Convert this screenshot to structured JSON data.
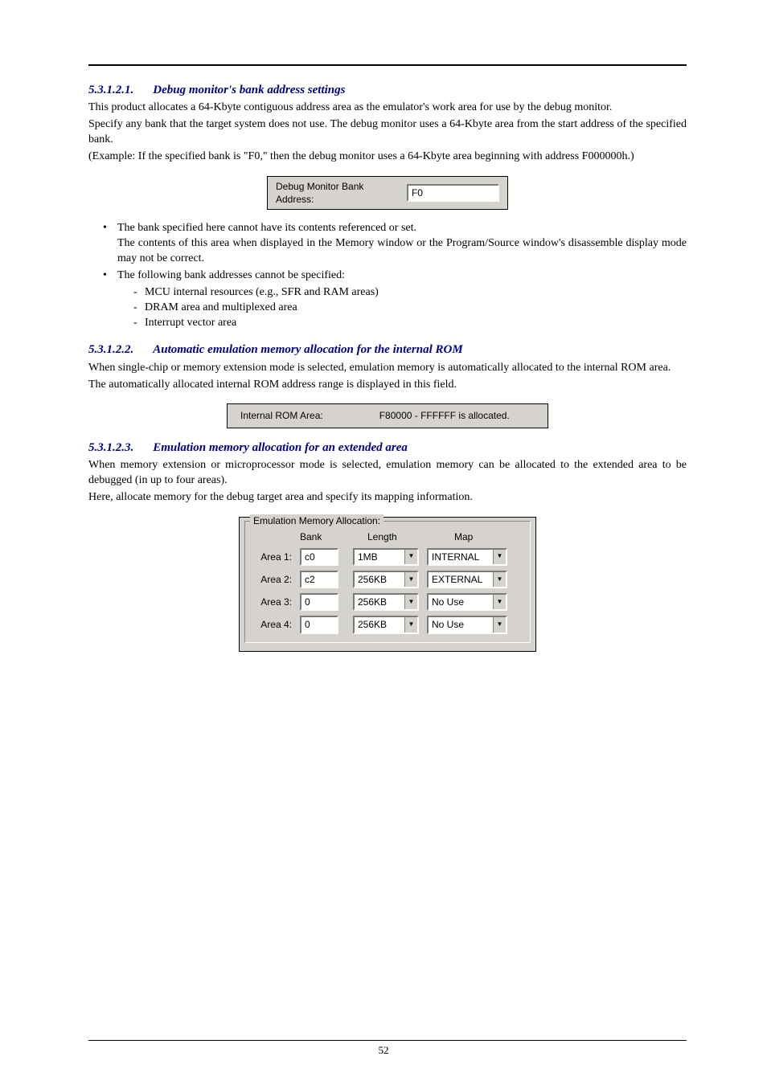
{
  "section1": {
    "num": "5.3.1.2.1.",
    "title": "Debug monitor's bank address settings",
    "p1": "This product allocates a 64-Kbyte contiguous address area as the emulator's work area for use by the debug monitor.",
    "p2": "Specify any bank that the target system does not use. The debug monitor uses a 64-Kbyte area from the start address of the specified bank.",
    "p3": "(Example: If the specified bank is \"F0,\" then the debug monitor uses a 64-Kbyte area beginning with address F000000h.)",
    "fig_label": "Debug Monitor Bank Address:",
    "fig_value": "F0",
    "bul1a": "The bank specified here cannot have its contents referenced or set.",
    "bul1b": "The contents of this area when displayed in the Memory window or the Program/Source window's disassemble display mode may not be correct.",
    "bul2": "The following bank addresses cannot be specified:",
    "dash1": "MCU internal resources (e.g., SFR and RAM areas)",
    "dash2": "DRAM area and multiplexed area",
    "dash3": "Interrupt vector area"
  },
  "section2": {
    "num": "5.3.1.2.2.",
    "title": "Automatic emulation memory allocation for the internal ROM",
    "p1": "When single-chip or memory extension mode is selected, emulation memory is automatically allocated to the internal ROM area.",
    "p2": "The automatically allocated internal ROM address range is displayed in this field.",
    "fig_label": "Internal ROM Area:",
    "fig_value": "F80000 - FFFFFF is allocated."
  },
  "section3": {
    "num": "5.3.1.2.3.",
    "title": "Emulation memory allocation for an extended area",
    "p1": "When memory extension or microprocessor mode is selected, emulation memory can be allocated to the extended area to be debugged (in up to four areas).",
    "p2": "Here, allocate memory for the debug target area and specify its mapping information.",
    "group_legend": "Emulation Memory Allocation:",
    "head_bank": "Bank",
    "head_len": "Length",
    "head_map": "Map",
    "rows": [
      {
        "label": "Area 1:",
        "bank": "c0",
        "length": "1MB",
        "map": "INTERNAL"
      },
      {
        "label": "Area 2:",
        "bank": "c2",
        "length": "256KB",
        "map": "EXTERNAL"
      },
      {
        "label": "Area 3:",
        "bank": "0",
        "length": "256KB",
        "map": "No Use"
      },
      {
        "label": "Area 4:",
        "bank": "0",
        "length": "256KB",
        "map": "No Use"
      }
    ]
  },
  "page_number": "52"
}
